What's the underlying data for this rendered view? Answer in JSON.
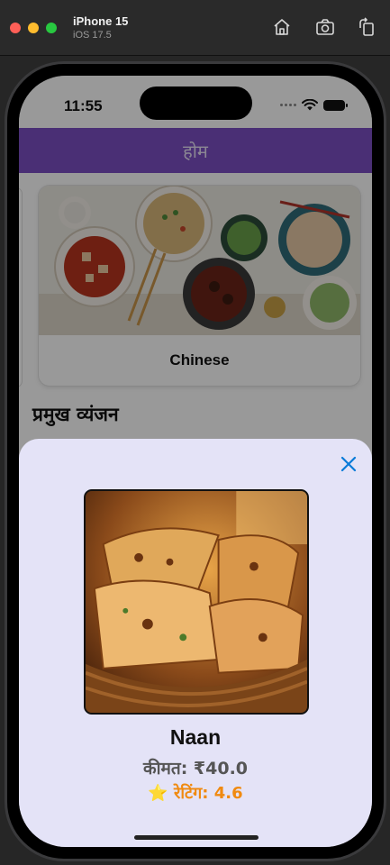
{
  "simulator": {
    "device_name": "iPhone 15",
    "os_version": "iOS 17.5"
  },
  "status_bar": {
    "time": "11:55"
  },
  "nav": {
    "title": "होम"
  },
  "category_card": {
    "label": "Chinese"
  },
  "section": {
    "title": "प्रमुख व्यंजन"
  },
  "sheet": {
    "dish_name": "Naan",
    "price": "कीमत: ₹40.0",
    "rating": "⭐ रेटिंग: 4.6"
  },
  "colors": {
    "nav_purple": "#7c4fc4",
    "sheet_bg": "#e4e3f7",
    "close_blue": "#0a7bd8",
    "rating_orange": "#f08a10"
  },
  "icons": [
    "home-icon",
    "screenshot-icon",
    "rotate-icon",
    "wifi-icon",
    "battery-icon",
    "close-icon",
    "star-icon"
  ]
}
